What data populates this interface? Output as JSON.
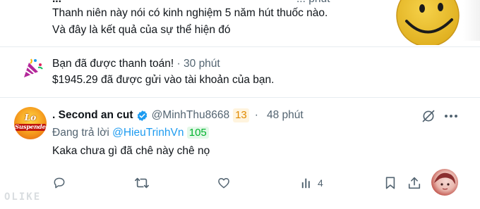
{
  "prev_tweet": {
    "cut_line": "...",
    "cut_time": "... phút",
    "line1": "Thanh niên này nói có kinh nghiệm 5 năm hút thuốc nào.",
    "line2": "Và đây là kết quả của sự thể hiện đó"
  },
  "notification": {
    "title": "Bạn đã được thanh toán!",
    "separator": "·",
    "time": "30 phút",
    "body": "$1945.29 đã được gửi vào tài khoản của bạn."
  },
  "reply_tweet": {
    "display_name": ". Second an cut",
    "handle": "@MinhThu8668",
    "badge_count": "13",
    "separator": "·",
    "time": "48 phút",
    "replying_prefix": "Đang trả lời",
    "replying_to": "@HieuTrinhVn",
    "replying_badge": "105",
    "text": "Kaka chưa gì đã chê này chê nọ",
    "avatar_text_top": "Lo",
    "avatar_text_bottom": "Suspended",
    "views": "4"
  },
  "watermark": "OLIKE",
  "colors": {
    "link": "#1d9bf0",
    "muted": "#536471",
    "verified": "#1d9bf0",
    "badge_orange": "#e08a00",
    "badge_green": "#00b32d"
  },
  "icons": [
    "party-popper-icon",
    "verified-icon",
    "grok-icon",
    "more-icon",
    "reply-icon",
    "retweet-icon",
    "like-icon",
    "views-icon",
    "bookmark-icon",
    "share-icon",
    "smiley-icon"
  ]
}
